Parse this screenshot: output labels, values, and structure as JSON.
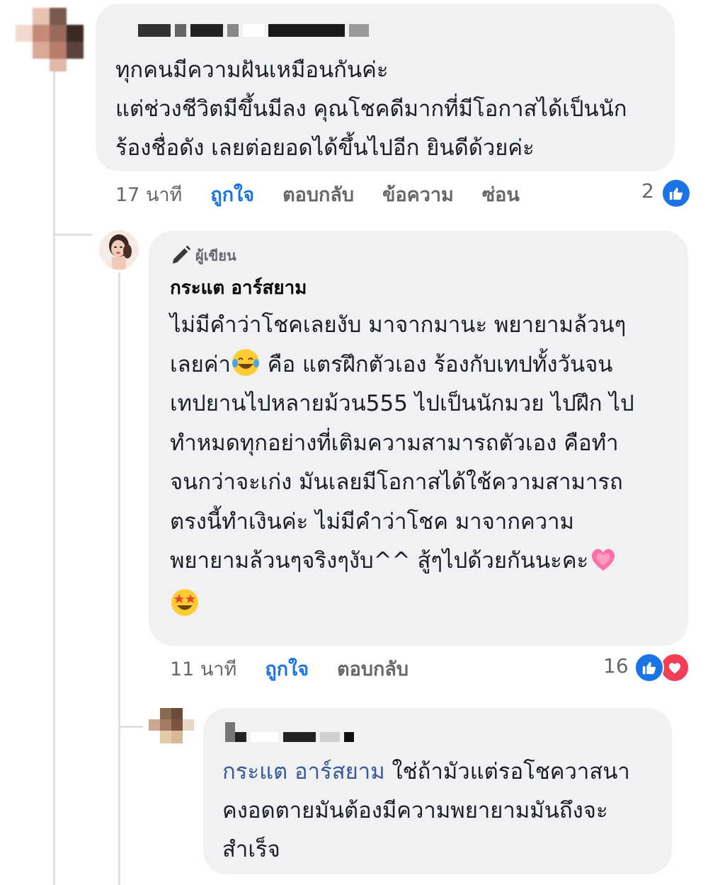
{
  "colors": {
    "accent": "#1b74e4",
    "bubble": "#eff1f3",
    "muted": "#65676b",
    "heart": "#f33e58"
  },
  "comment1": {
    "text": "ทุกคนมีความฝันเหมือนกันค่ะ\nแต่ช่วงชีวิตมีขึ้นมีลง คุณโชคดีมากที่มีโอกาสได้เป็นนัก\nร้องชื่อดัง เลยต่อยอดได้ขึ้นไปอีก ยินดีด้วยค่ะ",
    "time": "17 นาที",
    "like_label": "ถูกใจ",
    "reply_label": "ตอบกลับ",
    "message_label": "ข้อความ",
    "hide_label": "ซ่อน",
    "reaction_count": "2",
    "reaction_icons": [
      "like-icon"
    ]
  },
  "comment2": {
    "badge": "ผู้เขียน",
    "badge_icon": "pencil-icon",
    "author": "กระแต อาร์สยาม",
    "line1": "ไม่มีคำว่าโชคเลยงับ มาจากมานะ พยายามล้วนๆ",
    "line2a": "เลยค่า",
    "line2b": " คือ แตรฝึกตัวเอง ร้องกับเทปทั้งวันจน",
    "line3": "เทปยานไปหลายม้วน555 ไปเป็นนักมวย ไปฝึก ไป",
    "line4": "ทำหมดทุกอย่างที่เติมความสามารถตัวเอง คือทำ",
    "line5": "จนกว่าจะเก่ง มันเลยมีโอกาสได้ใช้ความสามารถ",
    "line6": "ตรงนี้ทำเงินค่ะ ไม่มีคำว่าโชค มาจากความ",
    "line7": "พยายามล้วนๆจริงๆงับ^^ สู้ๆไปด้วยกันนะคะ",
    "emojis": [
      "laughing-tears-emoji",
      "growing-heart-emoji",
      "star-struck-emoji"
    ],
    "time": "11 นาที",
    "like_label": "ถูกใจ",
    "reply_label": "ตอบกลับ",
    "reaction_count": "16",
    "reaction_icons": [
      "like-icon",
      "heart-icon"
    ]
  },
  "comment3": {
    "mention": "กระแต อาร์สยาม",
    "text_after_mention": " ใช่ถ้ามัวแต่รอโชควาสนา",
    "line2": "คงอดตายมันต้องมีความพยายามมันถึงจะ",
    "line3": "สำเร็จ"
  }
}
